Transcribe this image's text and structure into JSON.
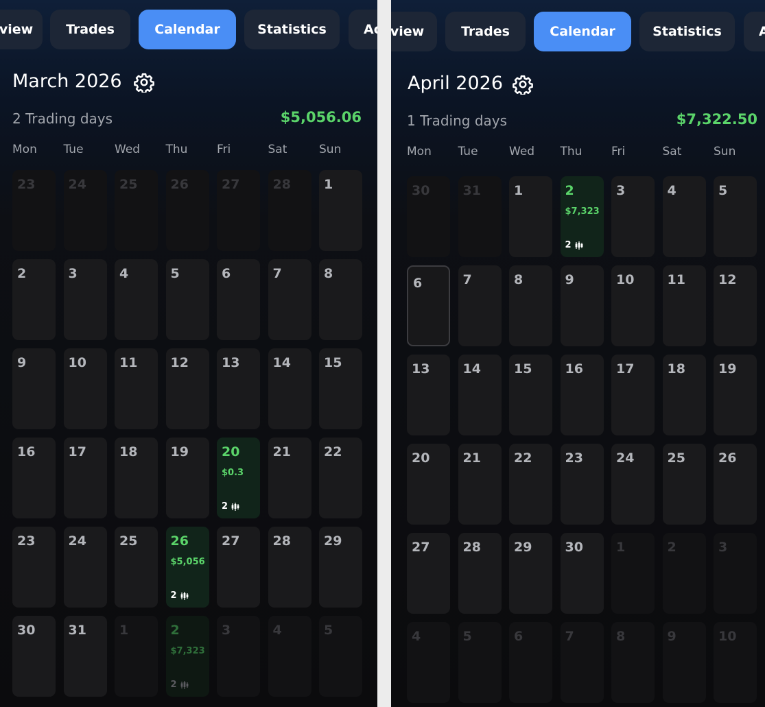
{
  "left": {
    "tabs": [
      {
        "label": "view",
        "active": false
      },
      {
        "label": "Trades",
        "active": false
      },
      {
        "label": "Calendar",
        "active": true
      },
      {
        "label": "Statistics",
        "active": false
      },
      {
        "label": "Ac",
        "active": false
      }
    ],
    "month_title": "March 2026",
    "trading_days": "2 Trading days",
    "month_total": "$5,056.06",
    "weekdays": [
      "Mon",
      "Tue",
      "Wed",
      "Thu",
      "Fri",
      "Sat",
      "Sun"
    ],
    "days": [
      {
        "day": "23",
        "faded": true
      },
      {
        "day": "24",
        "faded": true
      },
      {
        "day": "25",
        "faded": true
      },
      {
        "day": "26",
        "faded": true
      },
      {
        "day": "27",
        "faded": true
      },
      {
        "day": "28",
        "faded": true
      },
      {
        "day": "1"
      },
      {
        "day": "2"
      },
      {
        "day": "3"
      },
      {
        "day": "4"
      },
      {
        "day": "5"
      },
      {
        "day": "6"
      },
      {
        "day": "7"
      },
      {
        "day": "8"
      },
      {
        "day": "9"
      },
      {
        "day": "10"
      },
      {
        "day": "11"
      },
      {
        "day": "12"
      },
      {
        "day": "13"
      },
      {
        "day": "14"
      },
      {
        "day": "15"
      },
      {
        "day": "16"
      },
      {
        "day": "17"
      },
      {
        "day": "18"
      },
      {
        "day": "19"
      },
      {
        "day": "20",
        "pnl": "$0.3",
        "trades": "2"
      },
      {
        "day": "21"
      },
      {
        "day": "22"
      },
      {
        "day": "23"
      },
      {
        "day": "24"
      },
      {
        "day": "25"
      },
      {
        "day": "26",
        "pnl": "$5,056",
        "trades": "2"
      },
      {
        "day": "27"
      },
      {
        "day": "28"
      },
      {
        "day": "29"
      },
      {
        "day": "30"
      },
      {
        "day": "31"
      },
      {
        "day": "1",
        "faded": true
      },
      {
        "day": "2",
        "faded": true,
        "pnl": "$7,323",
        "trades": "2"
      },
      {
        "day": "3",
        "faded": true
      },
      {
        "day": "4",
        "faded": true
      },
      {
        "day": "5",
        "faded": true
      }
    ]
  },
  "right": {
    "tabs": [
      {
        "label": "view",
        "active": false
      },
      {
        "label": "Trades",
        "active": false
      },
      {
        "label": "Calendar",
        "active": true
      },
      {
        "label": "Statistics",
        "active": false
      },
      {
        "label": "A",
        "active": false
      }
    ],
    "month_title": "April 2026",
    "trading_days": "1 Trading days",
    "month_total": "$7,322.50",
    "weekdays": [
      "Mon",
      "Tue",
      "Wed",
      "Thu",
      "Fri",
      "Sat",
      "Sun"
    ],
    "days": [
      {
        "day": "30",
        "faded": true
      },
      {
        "day": "31",
        "faded": true
      },
      {
        "day": "1"
      },
      {
        "day": "2",
        "pnl": "$7,323",
        "trades": "2"
      },
      {
        "day": "3"
      },
      {
        "day": "4"
      },
      {
        "day": "5"
      },
      {
        "day": "6",
        "today": true
      },
      {
        "day": "7"
      },
      {
        "day": "8"
      },
      {
        "day": "9"
      },
      {
        "day": "10"
      },
      {
        "day": "11"
      },
      {
        "day": "12"
      },
      {
        "day": "13"
      },
      {
        "day": "14"
      },
      {
        "day": "15"
      },
      {
        "day": "16"
      },
      {
        "day": "17"
      },
      {
        "day": "18"
      },
      {
        "day": "19"
      },
      {
        "day": "20"
      },
      {
        "day": "21"
      },
      {
        "day": "22"
      },
      {
        "day": "23"
      },
      {
        "day": "24"
      },
      {
        "day": "25"
      },
      {
        "day": "26"
      },
      {
        "day": "27"
      },
      {
        "day": "28"
      },
      {
        "day": "29"
      },
      {
        "day": "30"
      },
      {
        "day": "1",
        "faded": true
      },
      {
        "day": "2",
        "faded": true
      },
      {
        "day": "3",
        "faded": true
      },
      {
        "day": "4",
        "faded": true
      },
      {
        "day": "5",
        "faded": true
      },
      {
        "day": "6",
        "faded": true
      },
      {
        "day": "7",
        "faded": true
      },
      {
        "day": "8",
        "faded": true
      },
      {
        "day": "9",
        "faded": true
      },
      {
        "day": "10",
        "faded": true
      }
    ]
  },
  "colors": {
    "accent": "#4a8ef5",
    "profit": "#5bd46a",
    "tab_bg": "#1d2636",
    "cell_bg": "#1a1a1c"
  },
  "icons": {
    "settings": "gear-icon",
    "trades": "candlestick-icon"
  }
}
